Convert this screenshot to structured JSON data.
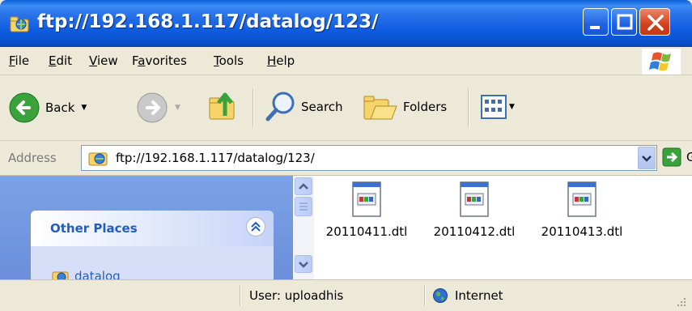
{
  "window": {
    "title": "ftp://192.168.1.117/datalog/123/",
    "title_icon": "ftp-folder-icon"
  },
  "menu": {
    "items": [
      {
        "accel": "F",
        "rest": "ile"
      },
      {
        "accel": "E",
        "rest": "dit"
      },
      {
        "accel": "V",
        "rest": "iew"
      },
      {
        "pre": "F",
        "accel": "a",
        "rest": "vorites"
      },
      {
        "accel": "T",
        "rest": "ools"
      },
      {
        "accel": "H",
        "rest": "elp"
      }
    ]
  },
  "toolbar": {
    "back_label": "Back",
    "search_label": "Search",
    "folders_label": "Folders"
  },
  "address": {
    "label": "Address",
    "value": "ftp://192.168.1.117/datalog/123/",
    "go_label": "Go"
  },
  "sidebar": {
    "panel_title": "Other Places",
    "link": "datalog"
  },
  "files": [
    {
      "name": "20110411.dtl"
    },
    {
      "name": "20110412.dtl"
    },
    {
      "name": "20110413.dtl"
    }
  ],
  "status": {
    "user": "User: uploadhis",
    "zone": "Internet"
  },
  "colors": {
    "titlebar": "#0a5fd8",
    "link": "#215dc6",
    "sidebar_bg": "#7ba2e7"
  }
}
